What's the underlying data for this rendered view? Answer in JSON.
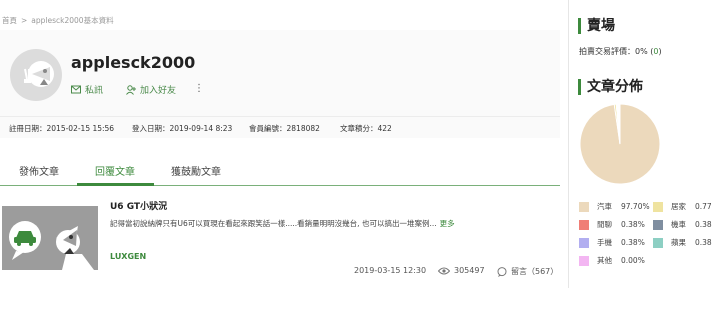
{
  "breadcrumb": {
    "home": "首頁",
    "sep": ">",
    "current": "applesck2000基本資料"
  },
  "profile": {
    "username": "applesck2000",
    "message_label": "私訊",
    "add_friend_label": "加入好友",
    "more_label": "⋮"
  },
  "stats": {
    "register": "註冊日期：2015-02-15 15:56",
    "login": "登入日期：2019-09-14 8:23",
    "member_id": "會員編號：2818082",
    "article_points": "文章積分：422"
  },
  "tabs": [
    "發佈文章",
    "回覆文章",
    "獲鼓勵文章"
  ],
  "active_tab": 1,
  "article": {
    "title": "U6 GT小狀況",
    "excerpt": "記得當初說納牌只有U6可以買現在看起來跟笑話一樣.....看銷量明明沒幾台, 也可以搞出一堆案例...",
    "more": "更多",
    "tag": "LUXGEN",
    "date": "2019-03-15 12:30",
    "views": "305497",
    "comments": "留言（567）"
  },
  "sidebar": {
    "market_title": "賣場",
    "auction_label": "拍賣交易評價：",
    "auction_value": "0%",
    "auction_count_open": "(",
    "auction_count": "0",
    "auction_count_close": ")",
    "dist_title": "文章分佈"
  },
  "chart_data": {
    "type": "pie",
    "title": "文章分佈",
    "series": [
      {
        "name": "汽車",
        "value": 97.7,
        "label": "97.70%",
        "color": "#ecd9bc"
      },
      {
        "name": "居家",
        "value": 0.77,
        "label": "0.77",
        "color": "#efe3a0"
      },
      {
        "name": "閒聊",
        "value": 0.38,
        "label": "0.38%",
        "color": "#f07e76"
      },
      {
        "name": "機車",
        "value": 0.38,
        "label": "0.38",
        "color": "#7f8ea0"
      },
      {
        "name": "手機",
        "value": 0.38,
        "label": "0.38%",
        "color": "#b2aef0"
      },
      {
        "name": "蘋果",
        "value": 0.38,
        "label": "0.38",
        "color": "#8dcfc3"
      },
      {
        "name": "其他",
        "value": 0.0,
        "label": "0.00%",
        "color": "#f3b6f2"
      }
    ]
  }
}
